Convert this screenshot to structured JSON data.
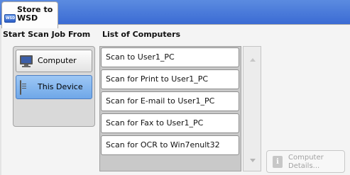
{
  "header": {
    "tab_label": "Store to WSD",
    "tab_icon": "wsd-icon"
  },
  "left_panel": {
    "title": "Start Scan Job From",
    "options": [
      {
        "label": "Computer",
        "icon": "computer-icon",
        "selected": false
      },
      {
        "label": "This Device",
        "icon": "document-icon",
        "selected": true
      }
    ]
  },
  "right_panel": {
    "title": "List of Computers",
    "items": [
      "Scan to User1_PC",
      "Scan for Print to User1_PC",
      "Scan for E-mail to User1_PC",
      "Scan for Fax to User1_PC",
      "Scan for OCR to Win7enult32"
    ]
  },
  "scrollbar": {
    "up_icon": "scroll-up-arrow-icon",
    "down_icon": "scroll-down-arrow-icon"
  },
  "details_button": {
    "label": "Computer Details...",
    "icon": "info-icon",
    "enabled": false
  },
  "colors": {
    "header_blue": "#3a6ad3",
    "selected_option": "#8dbcf0",
    "panel_bg": "#f4f4f4"
  }
}
